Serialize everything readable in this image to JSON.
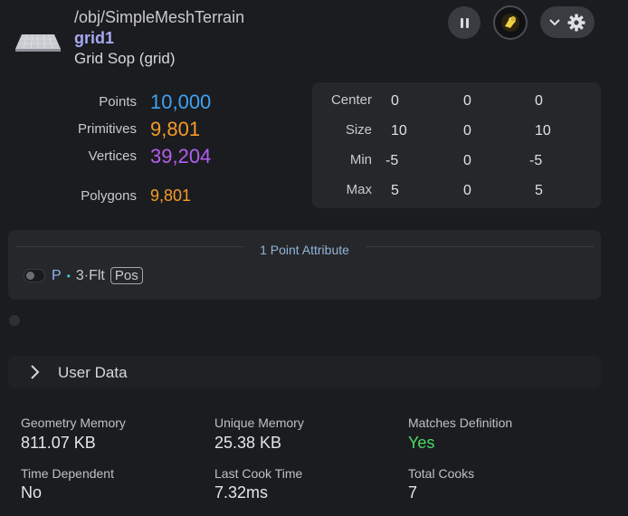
{
  "header": {
    "path": "/obj/SimpleMeshTerrain",
    "node_name": "grid1",
    "node_type": "Grid Sop (grid)"
  },
  "icons": {
    "node": "grid-geometry-icon",
    "pause": "pause-icon",
    "flag": "display-flag-icon",
    "dropdown": "chevron-down-icon",
    "settings": "gear-icon",
    "userdata": "chevron-right-icon"
  },
  "stats": {
    "points_label": "Points",
    "points_value": "10,000",
    "prims_label": "Primitives",
    "prims_value": "9,801",
    "verts_label": "Vertices",
    "verts_value": "39,204",
    "polys_label": "Polygons",
    "polys_value": "9,801"
  },
  "bounds": {
    "center_label": "Center",
    "center": [
      "0",
      "0",
      "0"
    ],
    "size_label": "Size",
    "size": [
      "10",
      "0",
      "10"
    ],
    "min_label": "Min",
    "min": [
      "-5",
      "0",
      "-5"
    ],
    "max_label": "Max",
    "max": [
      "5",
      "0",
      "5"
    ]
  },
  "attributes": {
    "title": "1 Point Attribute",
    "items": [
      {
        "name": "P",
        "separator": "•",
        "type": "3·Flt",
        "badge": "Pos"
      }
    ]
  },
  "user_data": {
    "label": "User Data"
  },
  "info": {
    "geo_mem_label": "Geometry Memory",
    "geo_mem_value": "811.07 KB",
    "unique_mem_label": "Unique Memory",
    "unique_mem_value": "25.38 KB",
    "matches_label": "Matches Definition",
    "matches_value": "Yes",
    "time_dep_label": "Time Dependent",
    "time_dep_value": "No",
    "cook_time_label": "Last Cook Time",
    "cook_time_value": "7.32ms",
    "total_cooks_label": "Total Cooks",
    "total_cooks_value": "7"
  },
  "colors": {
    "points": "#3fa1f3",
    "primitives": "#f49b2a",
    "vertices": "#b45ff0",
    "yes": "#4cd964",
    "node_name": "#a7a9f2"
  }
}
